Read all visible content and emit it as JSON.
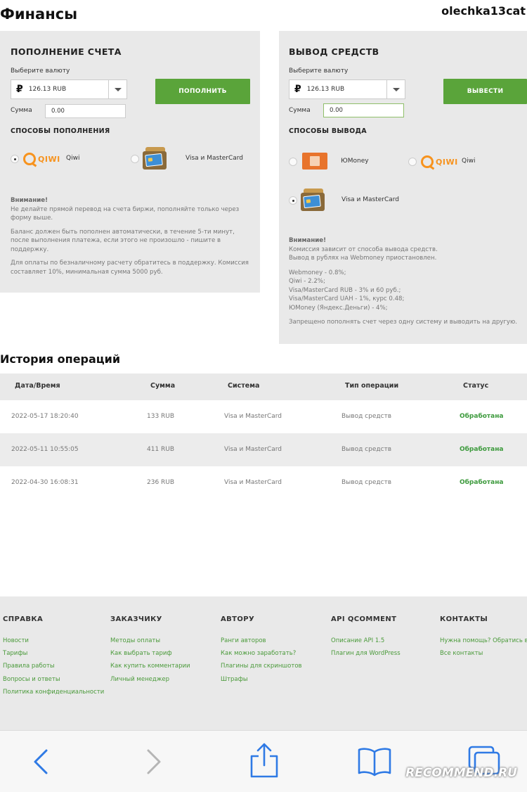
{
  "header": {
    "title": "Финансы",
    "username": "olechka13cat"
  },
  "deposit": {
    "title": "ПОПОЛНЕНИЕ СЧЕТА",
    "currency_label": "Выберите валюту",
    "currency_symbol": "₽",
    "currency_value": "126.13 RUB",
    "amount_label": "Сумма",
    "amount_value": "0.00",
    "button": "ПОПОЛНИТЬ",
    "methods_title": "СПОСОБЫ ПОПОЛНЕНИЯ",
    "method_qiwi": "Qiwi",
    "method_card": "Visa и MasterCard",
    "qiwi_logo_text": "QIWI",
    "notice": {
      "heading": "Внимание!",
      "p1": "Не делайте прямой перевод на счета биржи, пополняйте только через форму выше.",
      "p2": "Баланс должен быть пополнен автоматически, в течение 5-ти минут, после выполнения платежа, если этого не произошло - пишите в поддержку.",
      "p3": "Для оплаты по безналичному расчету обратитесь в поддержку. Комиссия составляет 10%, минимальная сумма 5000 руб."
    }
  },
  "withdraw": {
    "title": "ВЫВОД СРЕДСТВ",
    "currency_label": "Выберите валюту",
    "currency_symbol": "₽",
    "currency_value": "126.13 RUB",
    "amount_label": "Сумма",
    "amount_value": "0.00",
    "button": "ВЫВЕСТИ",
    "methods_title": "СПОСОБЫ ВЫВОДА",
    "method_ym": "ЮMoney",
    "method_qiwi": "Qiwi",
    "method_card": "Visa и MasterCard",
    "qiwi_logo_text": "QIWI",
    "notice": {
      "heading": "Внимание!",
      "l1": "Комиссия зависит от способа вывода средств.",
      "l2": "Вывод в рублях на Webmoney приостановлен.",
      "l3": "Webmoney - 0.8%;",
      "l4": "Qiwi - 2.2%;",
      "l5": "Visa/MasterCard RUB - 3% и 60 руб.;",
      "l6": "Visa/MasterCard UAH - 1%, курс 0.48;",
      "l7": "ЮMoney (Яндекс.Деньги) - 4%;",
      "l8": "Запрещено пополнять счет через одну систему и выводить на другую."
    }
  },
  "history": {
    "title": "История операций",
    "columns": [
      "Дата/Время",
      "Сумма",
      "Система",
      "Тип операции",
      "Статус"
    ],
    "rows": [
      {
        "date": "2022-05-17 18:20:40",
        "amount": "133 RUB",
        "system": "Visa и MasterCard",
        "type": "Вывод средств",
        "status": "Обработана"
      },
      {
        "date": "2022-05-11 10:55:05",
        "amount": "411 RUB",
        "system": "Visa и MasterCard",
        "type": "Вывод средств",
        "status": "Обработана"
      },
      {
        "date": "2022-04-30 16:08:31",
        "amount": "236 RUB",
        "system": "Visa и MasterCard",
        "type": "Вывод средств",
        "status": "Обработана"
      }
    ]
  },
  "footer": {
    "columns": [
      {
        "title": "СПРАВКА",
        "links": [
          "Новости",
          "Тарифы",
          "Правила работы",
          "Вопросы и ответы",
          "Политика конфиденциальности"
        ]
      },
      {
        "title": "ЗАКАЗЧИКУ",
        "links": [
          "Методы оплаты",
          "Как выбрать тариф",
          "Как купить комментарии",
          "Личный менеджер"
        ]
      },
      {
        "title": "АВТОРУ",
        "links": [
          "Ранги авторов",
          "Как можно заработать?",
          "Плагины для скриншотов",
          "Штрафы"
        ]
      },
      {
        "title": "API QCOMMENT",
        "links": [
          "Описание API 1.5",
          "Плагин для WordPress"
        ]
      },
      {
        "title": "КОНТАКТЫ",
        "links": [
          "Нужна помощь? Обратись в с",
          "Все контакты"
        ]
      }
    ]
  },
  "browser": {
    "icons": [
      "back-icon",
      "forward-icon",
      "share-icon",
      "bookmarks-icon",
      "tabs-icon"
    ],
    "accent": "#2f7ae5"
  },
  "watermark": "RECOMMEND.RU",
  "colors": {
    "green": "#5aa43a",
    "status_green": "#3c9a3c",
    "qiwi_orange": "#f7931e",
    "panel_bg": "#e9e9e9"
  }
}
